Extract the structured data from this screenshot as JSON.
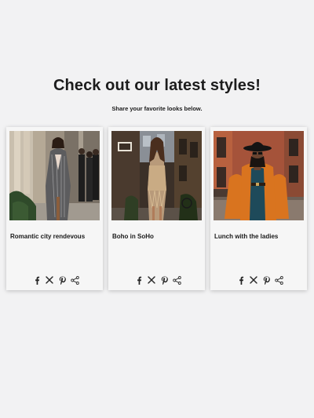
{
  "header": {
    "title": "Check out our latest styles!",
    "subtitle": "Share your favorite looks below."
  },
  "cards": [
    {
      "title": "Romantic city rendevous",
      "image": "woman in pinstripe suit dress on city sidewalk"
    },
    {
      "title": "Boho in SoHo",
      "image": "woman in fringed sequin dress on city street"
    },
    {
      "title": "Lunch with the ladies",
      "image": "woman in orange coat and black hat on brick street"
    }
  ],
  "share_icons": [
    "facebook-icon",
    "x-icon",
    "pinterest-icon",
    "share-icon"
  ]
}
